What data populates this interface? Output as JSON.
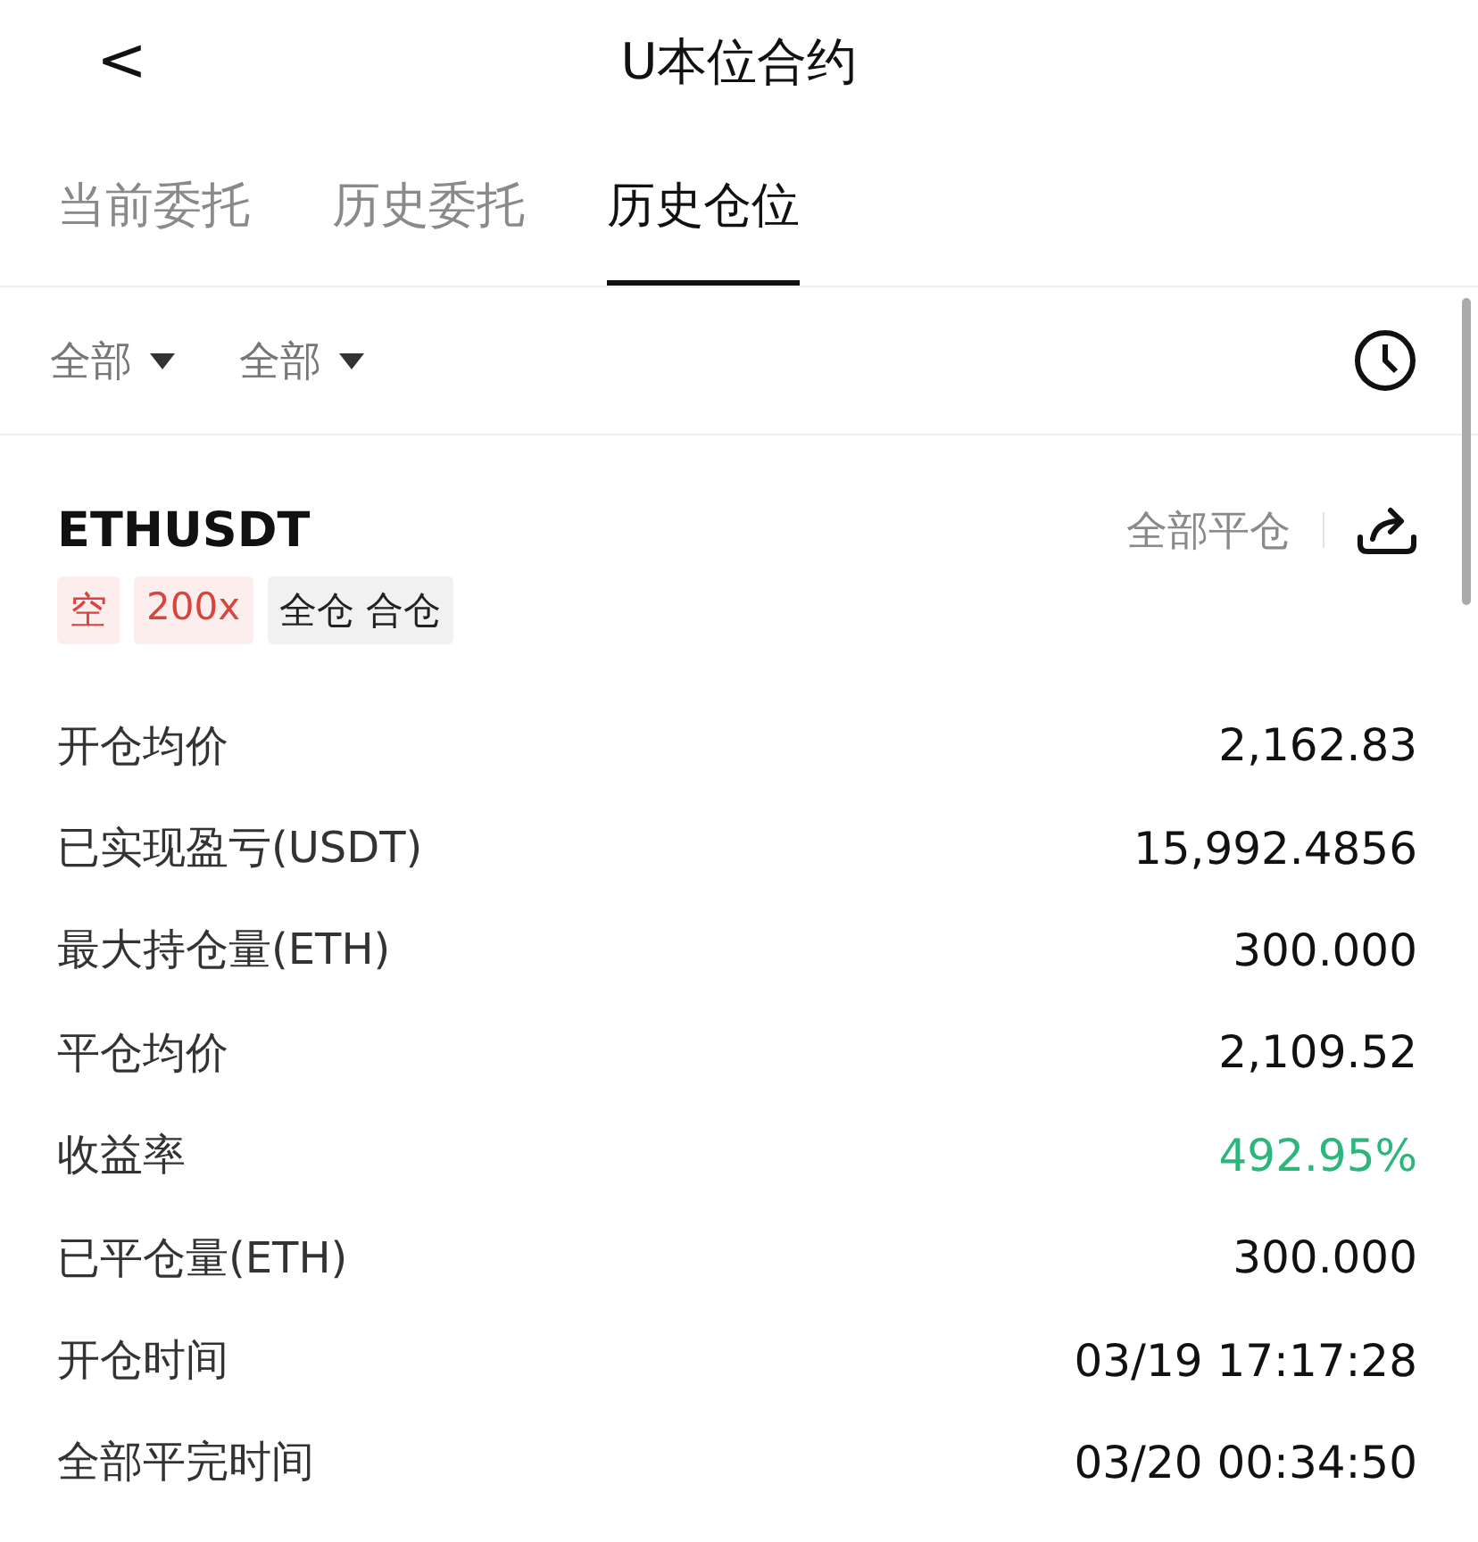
{
  "header": {
    "back": "<",
    "title": "U本位合约"
  },
  "tabs": [
    {
      "label": "当前委托",
      "selected": false
    },
    {
      "label": "历史委托",
      "selected": false
    },
    {
      "label": "历史仓位",
      "selected": true
    }
  ],
  "filters": [
    {
      "label": "全部"
    },
    {
      "label": "全部"
    }
  ],
  "position": {
    "symbol": "ETHUSDT",
    "action": "全部平仓",
    "tags": [
      {
        "label": "空",
        "kind": "alert"
      },
      {
        "label": "200x",
        "kind": "alert"
      },
      {
        "label": "全仓 合仓",
        "kind": "neutral"
      }
    ],
    "rows": [
      {
        "label": "开仓均价",
        "value": "2,162.83",
        "kind": "plain"
      },
      {
        "label": "已实现盈亏(USDT)",
        "value": "15,992.4856",
        "kind": "plain"
      },
      {
        "label": "最大持仓量(ETH)",
        "value": "300.000",
        "kind": "plain"
      },
      {
        "label": "平仓均价",
        "value": "2,109.52",
        "kind": "plain"
      },
      {
        "label": "收益率",
        "value": "492.95%",
        "kind": "gain"
      },
      {
        "label": "已平仓量(ETH)",
        "value": "300.000",
        "kind": "plain"
      },
      {
        "label": "开仓时间",
        "value": "03/19 17:17:28",
        "kind": "plain"
      },
      {
        "label": "全部平完时间",
        "value": "03/20 00:34:50",
        "kind": "plain"
      }
    ]
  }
}
